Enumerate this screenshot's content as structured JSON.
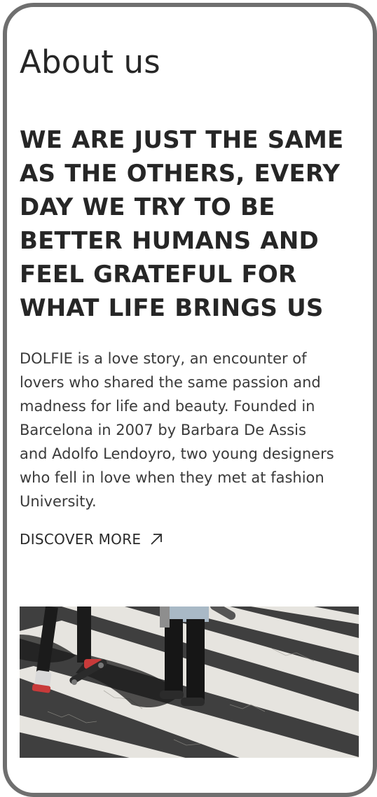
{
  "page": {
    "title": "About us",
    "headline_lines": [
      "WE ARE JUST THE SAME",
      "AS THE OTHERS, EVERY",
      "DAY WE TRY TO BE",
      "BETTER HUMANS AND",
      "FEEL GRATEFUL FOR",
      "WHAT LIFE BRINGS US"
    ],
    "body_lines": [
      "DOLFIE is a love story, an encounter of",
      "lovers who shared the same passion and",
      "madness for life and beauty. Founded in",
      "Barcelona in 2007 by Barbara De Assis",
      "and Adolfo Lendoyro, two young designers",
      "who fell in love when they met at fashion",
      "University."
    ],
    "discover_label": "DISCOVER MORE",
    "discover_icon": "arrow-up-right-icon",
    "photo_subject": "people crossing a zebra crosswalk"
  },
  "colors": {
    "frame": "#6f6f6f",
    "text": "#262626",
    "background": "#ffffff"
  }
}
